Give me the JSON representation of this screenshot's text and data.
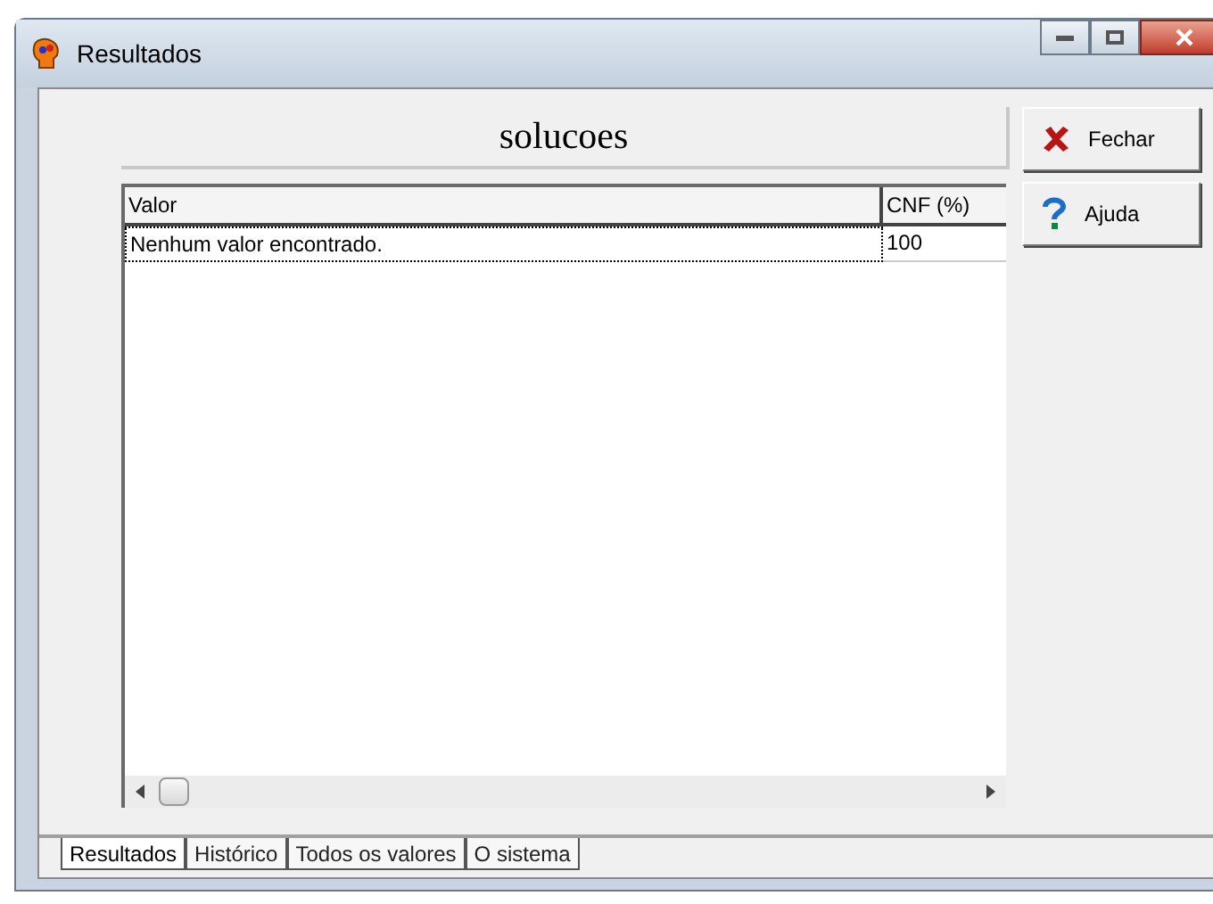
{
  "window": {
    "title": "Resultados"
  },
  "header": "solucoes",
  "table": {
    "columns": [
      "Valor",
      "CNF (%)"
    ],
    "rows": [
      {
        "cells": [
          "Nenhum valor encontrado.",
          "100"
        ],
        "selected": true
      }
    ]
  },
  "buttons": [
    {
      "kind": "close",
      "label": "Fechar"
    },
    {
      "kind": "help",
      "label": "Ajuda"
    }
  ],
  "tabs": [
    {
      "label": "Resultados",
      "selected": true
    },
    {
      "label": "Histórico",
      "selected": false
    },
    {
      "label": "Todos os valores",
      "selected": false
    },
    {
      "label": "O sistema",
      "selected": false
    }
  ]
}
